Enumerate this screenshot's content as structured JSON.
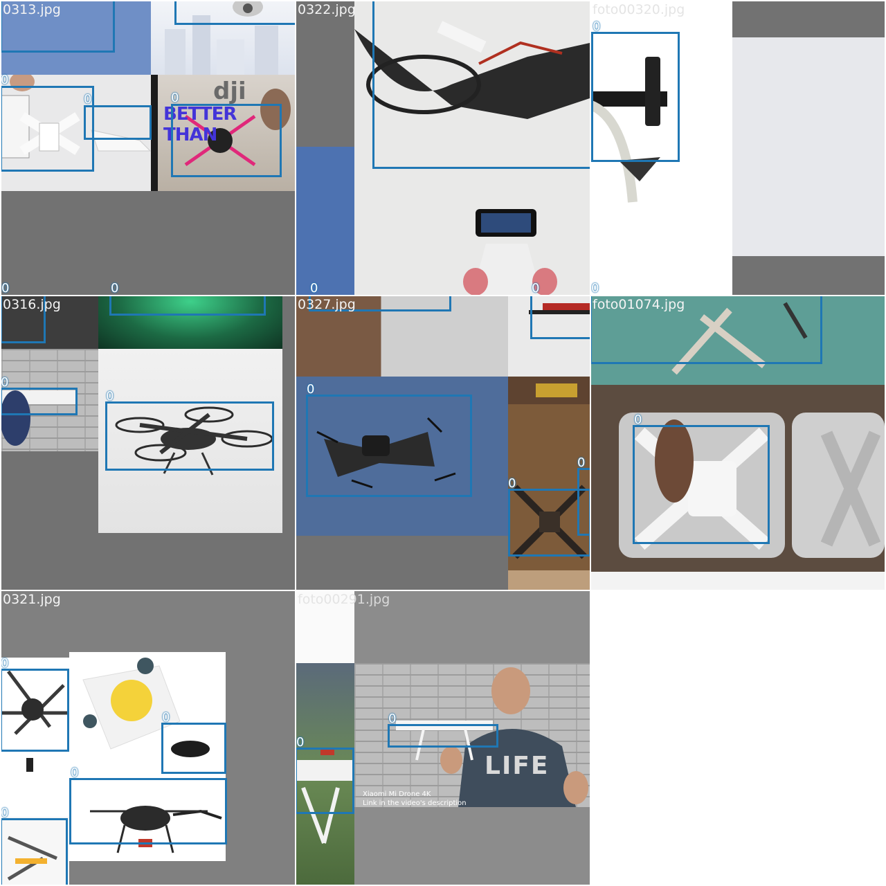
{
  "tiles": [
    {
      "title": "0313.jpg",
      "labels": [
        "0",
        "0",
        "0",
        "0",
        "0",
        "0"
      ]
    },
    {
      "title": "0322.jpg",
      "labels": [
        "0",
        "0",
        "0"
      ]
    },
    {
      "title": "foto00320.jpg",
      "labels": [
        "0",
        "0"
      ]
    },
    {
      "title": "0316.jpg",
      "labels": [
        "0",
        "0"
      ]
    },
    {
      "title": "0327.jpg",
      "labels": [
        "0",
        "0",
        "0"
      ]
    },
    {
      "title": "foto01074.jpg",
      "labels": [
        "0"
      ]
    },
    {
      "title": "0321.jpg",
      "labels": [
        "0",
        "0",
        "0",
        "0"
      ]
    },
    {
      "title": "foto00291.jpg",
      "labels": [
        "0",
        "0"
      ]
    }
  ],
  "overlay_text": {
    "dji_logo": "dji",
    "better_than": "BETTER THAN",
    "shirt_text": "LIFE",
    "video_caption_1": "Xiaomi Mi Drone 4K",
    "video_caption_2": "Link in the video's description"
  },
  "colors": {
    "box": "#1f77b4",
    "background_gray": "#727272"
  }
}
